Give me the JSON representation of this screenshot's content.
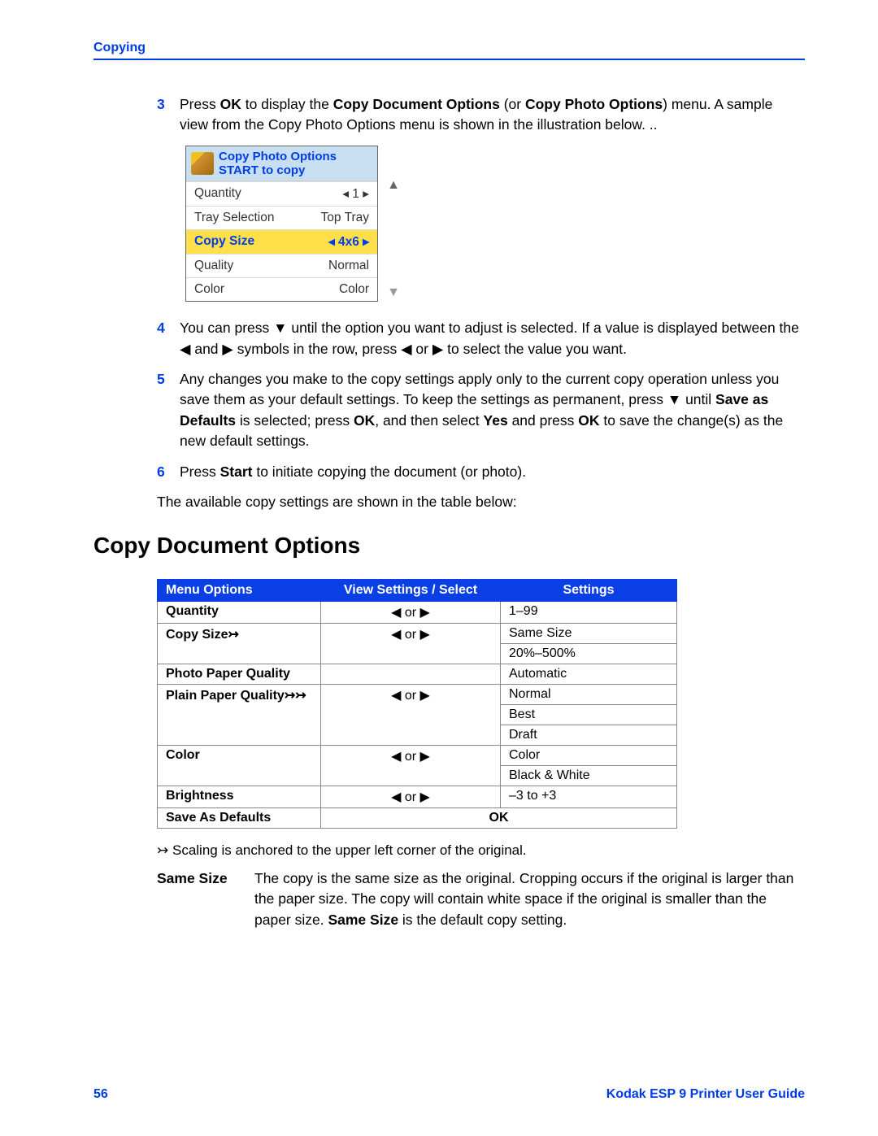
{
  "header": "Copying",
  "steps": {
    "3": {
      "pre": "Press ",
      "b1": "OK",
      "mid1": " to display the ",
      "b2": "Copy Document Options",
      "mid2": " (or ",
      "b3": "Copy Photo Options",
      "mid3": ") menu. A sample view from the Copy Photo Options menu is shown in the illustration below. .."
    },
    "4": {
      "t1": "You can press ",
      "t2": " until the option you want to adjust is selected. If a value is displayed between the ",
      "t3": " and ",
      "t4": " symbols in the row, press ",
      "t5": " or ",
      "t6": " to select the value you want."
    },
    "5": {
      "t1": "Any changes you make to the copy settings apply only to the current copy operation unless you save them as your default settings. To keep the settings as permanent, press ",
      "t2": " until ",
      "b1": "Save as Defaults",
      "t3": " is selected; press ",
      "b2": "OK",
      "t4": ", and then select ",
      "b3": "Yes",
      "t5": " and press ",
      "b4": "OK",
      "t6": " to save the change(s) as the new default settings."
    },
    "6": {
      "t1": "Press ",
      "b1": "Start",
      "t2": " to initiate copying the document (or photo)."
    }
  },
  "lcd": {
    "title1": "Copy Photo Options",
    "title2": "START to copy",
    "rows": [
      {
        "label": "Quantity",
        "value": "◂ 1 ▸",
        "sel": false
      },
      {
        "label": "Tray Selection",
        "value": "Top Tray",
        "sel": false
      },
      {
        "label": "Copy Size",
        "value": "◂ 4x6 ▸",
        "sel": true
      },
      {
        "label": "Quality",
        "value": "Normal",
        "sel": false
      },
      {
        "label": "Color",
        "value": "Color",
        "sel": false
      }
    ]
  },
  "intro_para": "The available copy settings are shown in the table below:",
  "section_title": "Copy Document Options",
  "table": {
    "h1": "Menu Options",
    "h2": "View Settings / Select",
    "h3": "Settings",
    "rows": [
      {
        "m": "Quantity",
        "c": "◀  or  ▶",
        "s": [
          "1–99"
        ]
      },
      {
        "m": "Copy Size",
        "star": 1,
        "c": "◀  or  ▶",
        "s": [
          "Same Size",
          "20%–500%"
        ]
      },
      {
        "m": "Photo Paper Quality",
        "c": "",
        "s": [
          "Automatic"
        ]
      },
      {
        "m": "Plain Paper Quality",
        "star": 2,
        "c": "◀  or  ▶",
        "s": [
          "Normal",
          "Best",
          "Draft"
        ]
      },
      {
        "m": "Color",
        "c": "◀  or  ▶",
        "s": [
          "Color",
          "Black & White"
        ]
      },
      {
        "m": "Brightness",
        "c": "◀  or  ▶",
        "s": [
          "–3 to +3"
        ]
      },
      {
        "m": "Save As Defaults",
        "c": "OK",
        "s": [
          ""
        ],
        "cbold": true,
        "merge": true
      }
    ]
  },
  "footnote": {
    "sym": "↣",
    "text": "Scaling is anchored to the upper left corner of the original."
  },
  "defn": {
    "term": "Same Size",
    "d1": "The copy is the same size as the original. Cropping occurs if the original is larger than the paper size. The copy will contain white space if the original is smaller than the paper size. ",
    "b": "Same Size",
    "d2": " is the default copy setting."
  },
  "footer": {
    "page": "56",
    "guide": "Kodak ESP 9 Printer User Guide"
  }
}
